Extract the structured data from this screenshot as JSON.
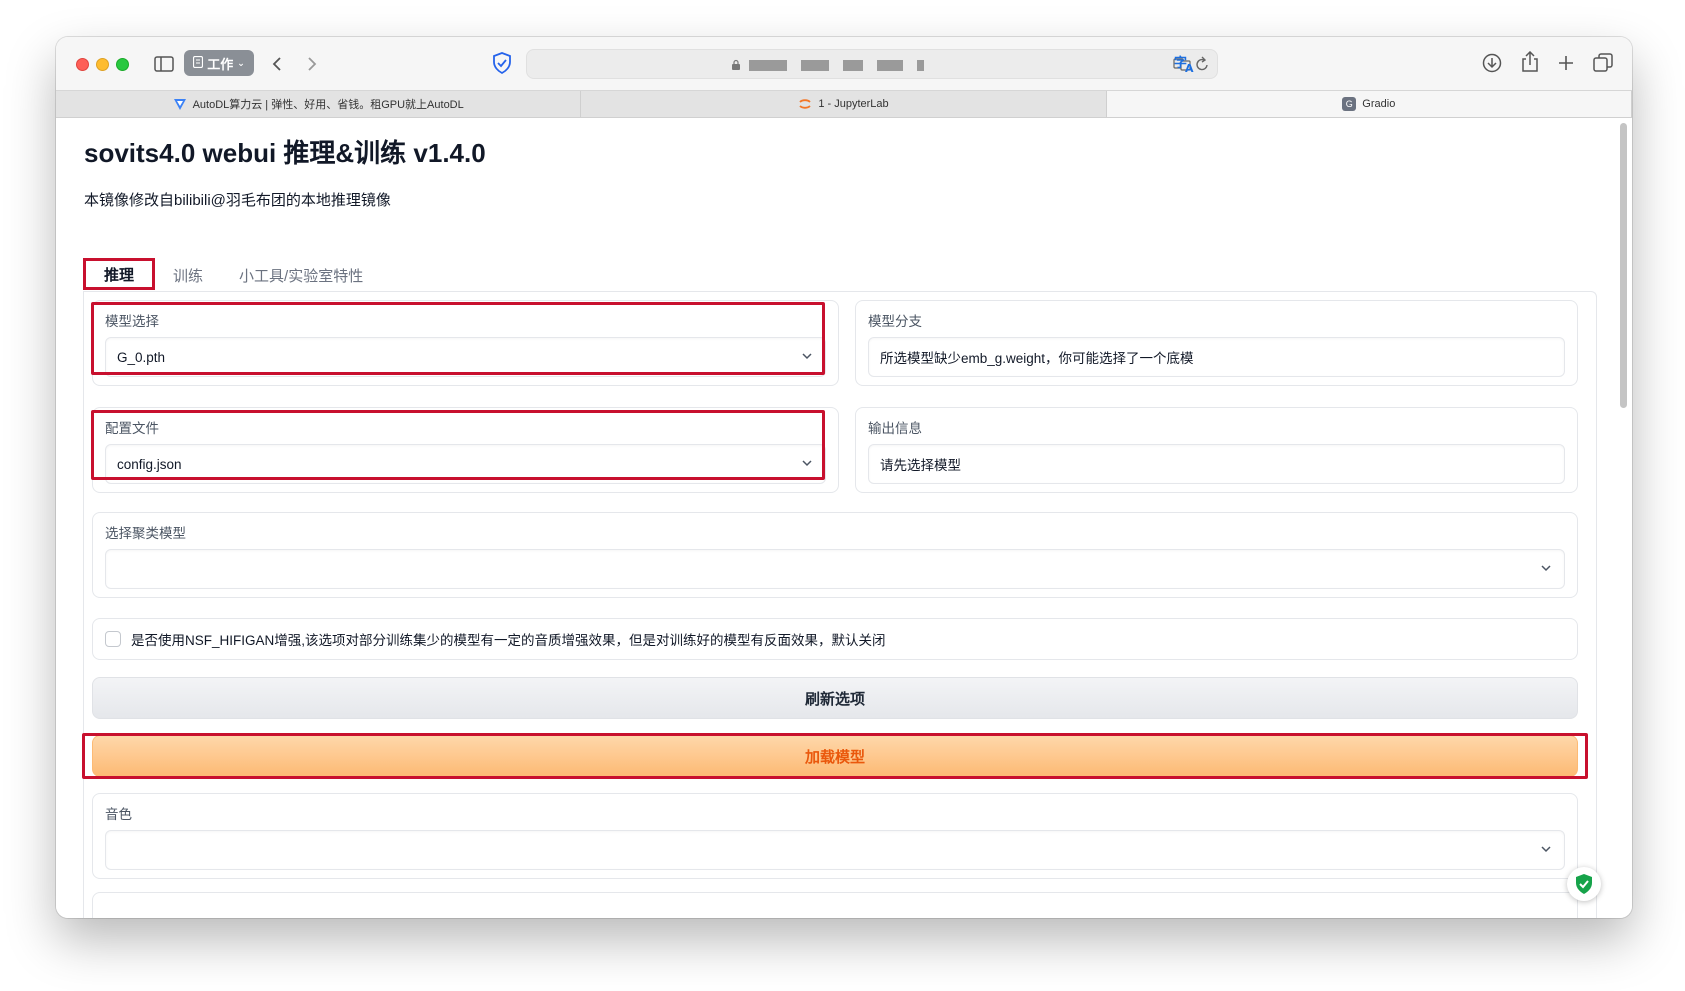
{
  "browser": {
    "tab_group_label": "工作",
    "address_text": "",
    "tabs": [
      {
        "label": "AutoDL算力云 | 弹性、好用、省钱。租GPU就上AutoDL",
        "favicon": "autodl-logo-icon"
      },
      {
        "label": "1 - JupyterLab",
        "favicon": "jupyter-logo-icon"
      },
      {
        "label": "Gradio",
        "favicon": "gradio-logo-icon"
      }
    ]
  },
  "app": {
    "title": "sovits4.0 webui 推理&训练 v1.4.0",
    "description": "本镜像修改自bilibili@羽毛布团的本地推理镜像"
  },
  "tabs": [
    {
      "label": "推理",
      "selected": true
    },
    {
      "label": "训练",
      "selected": false
    },
    {
      "label": "小工具/实验室特性",
      "selected": false
    }
  ],
  "inference": {
    "model_select": {
      "label": "模型选择",
      "value": "G_0.pth"
    },
    "model_branch": {
      "label": "模型分支",
      "value": "所选模型缺少emb_g.weight，你可能选择了一个底模"
    },
    "config_file": {
      "label": "配置文件",
      "value": "config.json"
    },
    "output_info": {
      "label": "输出信息",
      "value": "请先选择模型"
    },
    "cluster_model": {
      "label": "选择聚类模型",
      "value": ""
    },
    "nsf_checkbox": {
      "label": "是否使用NSF_HIFIGAN增强,该选项对部分训练集少的模型有一定的音质增强效果，但是对训练好的模型有反面效果，默认关闭",
      "checked": false
    },
    "refresh_button": "刷新选项",
    "load_button": "加载模型",
    "timbre": {
      "label": "音色",
      "value": ""
    }
  },
  "colors": {
    "highlight": "#c8102e",
    "load_button_text": "#ea580c",
    "load_button_bg": "#fdba74"
  }
}
